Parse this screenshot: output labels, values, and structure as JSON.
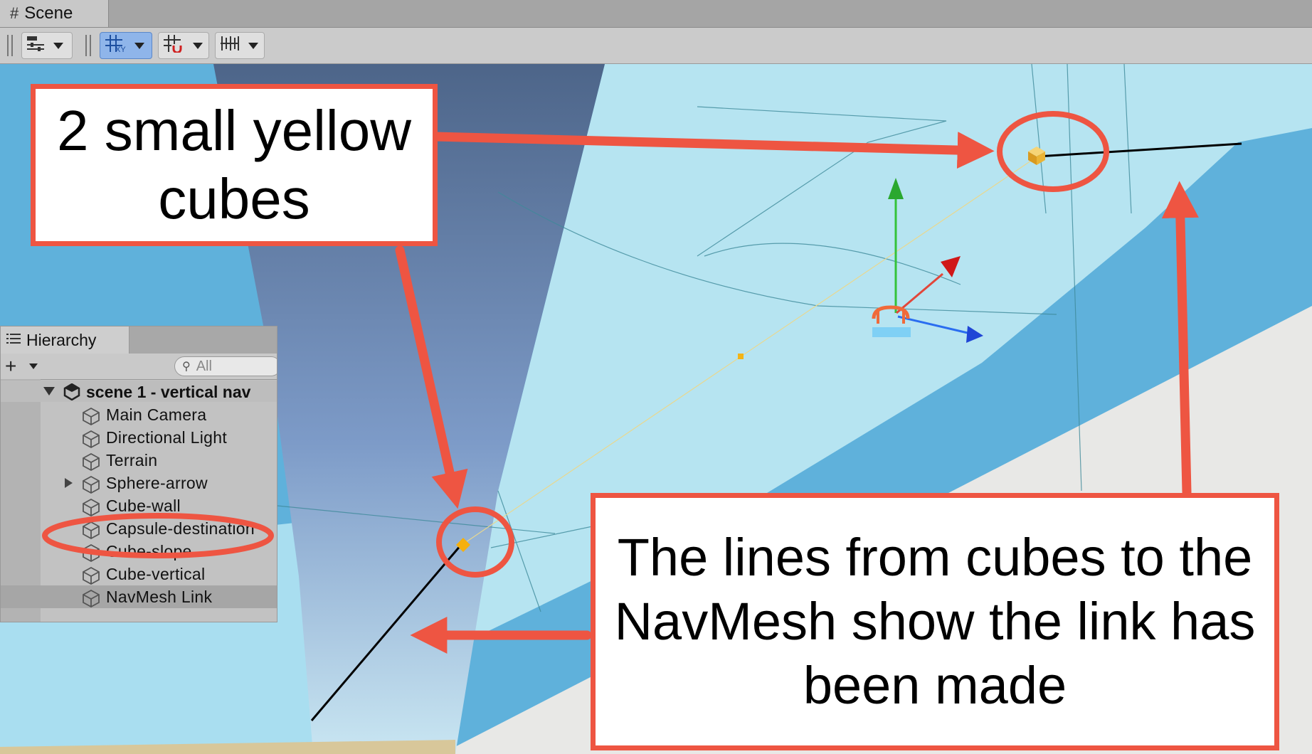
{
  "window": {
    "tab_label": "Scene",
    "tab_icon": "grid-icon"
  },
  "toolbar": {
    "buttons": [
      {
        "name": "draw-mode-button",
        "icon": "sliders-icon"
      },
      {
        "name": "grid-snap-button",
        "icon": "grid-axis-icon",
        "active": true
      },
      {
        "name": "snapping-button",
        "icon": "magnet-grid-icon"
      },
      {
        "name": "increment-snap-button",
        "icon": "ruler-icon"
      }
    ]
  },
  "hierarchy": {
    "tab_label": "Hierarchy",
    "add_label": "+",
    "search_placeholder": "All",
    "scene_label": "scene 1 - vertical nav",
    "items": [
      {
        "label": "Main Camera",
        "expandable": false
      },
      {
        "label": "Directional Light",
        "expandable": false
      },
      {
        "label": "Terrain",
        "expandable": false
      },
      {
        "label": "Sphere-arrow",
        "expandable": true
      },
      {
        "label": "Cube-wall",
        "expandable": false
      },
      {
        "label": "Capsule-destination",
        "expandable": false
      },
      {
        "label": "Cube-slope",
        "expandable": false
      },
      {
        "label": "Cube-vertical",
        "expandable": false
      },
      {
        "label": "NavMesh Link",
        "expandable": false,
        "selected": true
      }
    ]
  },
  "annotations": {
    "top_callout": "2 small yellow cubes",
    "bottom_callout": "The lines from cubes to the NavMesh show the link has been made"
  },
  "colors": {
    "callout_border": "#ee5542",
    "navmesh": "#b5e3f0",
    "wall": "#6a86b3",
    "link_cube": "#f0b000",
    "axis_x": "#e02020",
    "axis_y": "#2cc02c",
    "axis_z": "#2050e0"
  }
}
